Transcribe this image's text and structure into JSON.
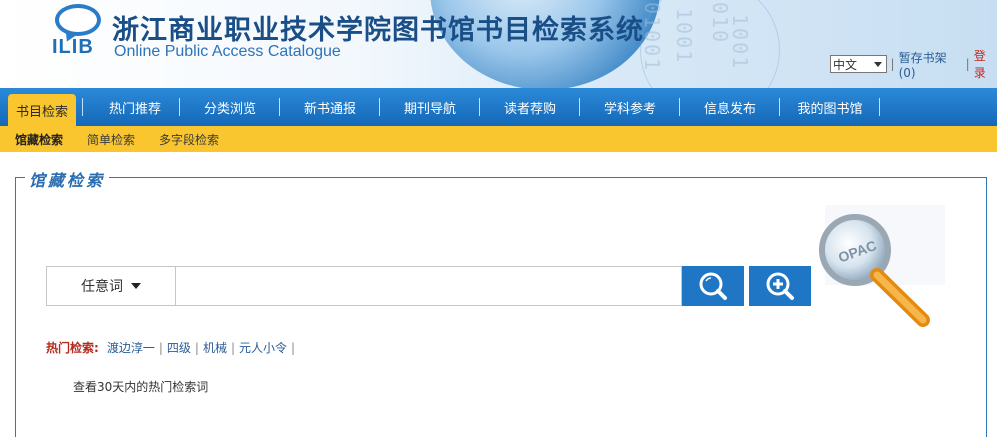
{
  "header": {
    "logo_text": "ILIB",
    "title": "浙江商业职业技术学院图书馆书目检索系统",
    "subtitle": "Online Public Access Catalogue",
    "lang_selected": "中文",
    "bookshelf_link": "暂存书架(0)",
    "login_link": "登录",
    "separator": "|"
  },
  "nav": {
    "items": [
      {
        "label": "书目检索",
        "active": true
      },
      {
        "label": "热门推荐"
      },
      {
        "label": "分类浏览"
      },
      {
        "label": "新书通报"
      },
      {
        "label": "期刊导航"
      },
      {
        "label": "读者荐购"
      },
      {
        "label": "学科参考"
      },
      {
        "label": "信息发布"
      },
      {
        "label": "我的图书馆"
      }
    ]
  },
  "subnav": {
    "items": [
      {
        "label": "馆藏检索",
        "active": true
      },
      {
        "label": "简单检索"
      },
      {
        "label": "多字段检索"
      }
    ]
  },
  "panel": {
    "legend": "馆藏检索",
    "field_select": "任意词",
    "search_value": "",
    "art_text": "OPAC",
    "hot_label": "热门检索:",
    "hot_items": [
      "渡边淳一",
      "四级",
      "机械",
      "元人小令"
    ],
    "hot_sep": "|",
    "hot_more": "查看30天内的热门检索词"
  },
  "colors": {
    "nav_blue": "#1f76c5",
    "nav_active": "#f9c62f",
    "title_blue": "#1a4e86",
    "hot_label_red": "#b52a1f"
  }
}
